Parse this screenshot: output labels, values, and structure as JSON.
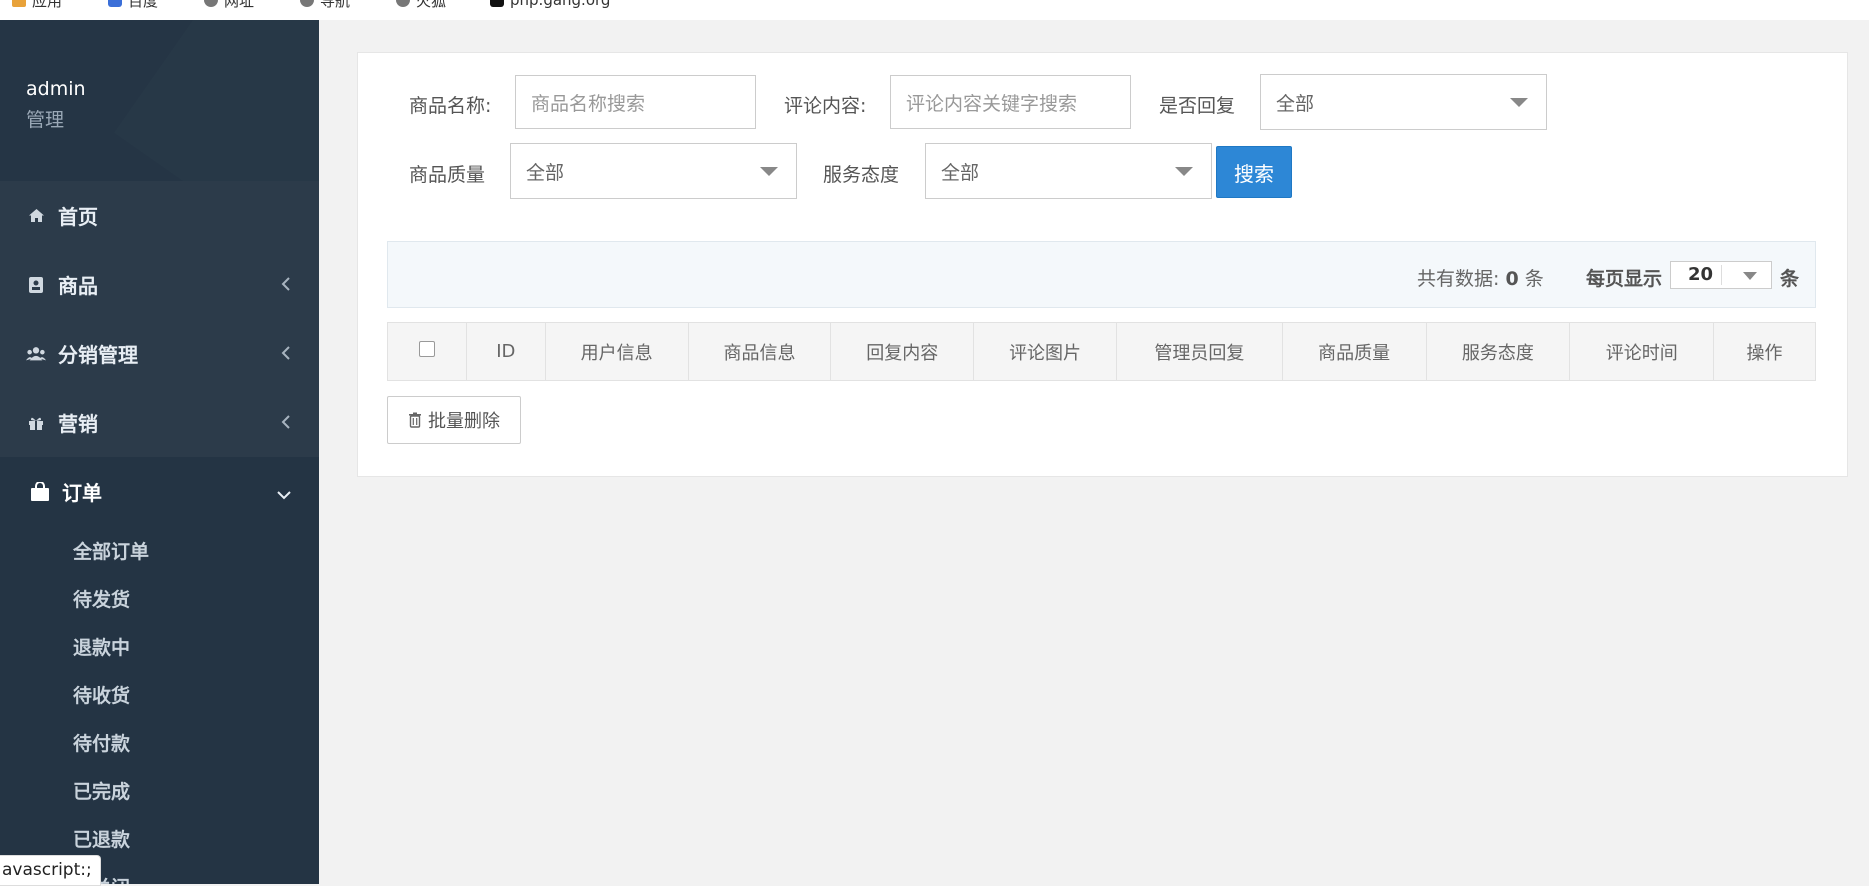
{
  "browser": {
    "bookmarks": [
      {
        "label": "应用",
        "icon": "apps-icon",
        "color": "#e8a23a"
      },
      {
        "label": "百度",
        "icon": "baidu-icon",
        "color": "#3b6fd8"
      },
      {
        "label": "网址",
        "icon": "globe-icon",
        "color": "#777777"
      },
      {
        "label": "导航",
        "icon": "globe-icon",
        "color": "#777777"
      },
      {
        "label": "火狐",
        "icon": "globe-icon",
        "color": "#777777"
      },
      {
        "label": "php.gang.org",
        "icon": "site-icon",
        "color": "#111111"
      }
    ]
  },
  "sidebar": {
    "user_name": "admin",
    "user_role": "管理",
    "menu": [
      {
        "label": "首页",
        "icon": "home-icon",
        "has_arrow": false
      },
      {
        "label": "商品",
        "icon": "product-book-icon",
        "has_arrow": true
      },
      {
        "label": "分销管理",
        "icon": "users-icon",
        "has_arrow": true
      },
      {
        "label": "营销",
        "icon": "gift-icon",
        "has_arrow": true
      },
      {
        "label": "订单",
        "icon": "shopping-bag-icon",
        "has_arrow": true,
        "expanded": true
      }
    ],
    "order_submenu": [
      "全部订单",
      "待发货",
      "退款中",
      "待收货",
      "待付款",
      "已完成",
      "已退款",
      "已关闭"
    ],
    "status_text": "avascript:;"
  },
  "filters": {
    "product_name_label": "商品名称:",
    "product_name_placeholder": "商品名称搜索",
    "comment_label": "评论内容:",
    "comment_placeholder": "评论内容关键字搜索",
    "replied_label": "是否回复",
    "replied_value": "全部",
    "quality_label": "商品质量",
    "quality_value": "全部",
    "service_label": "服务态度",
    "service_value": "全部",
    "search_button": "搜索"
  },
  "summary": {
    "total_label": "共有数据:",
    "total_value": "0",
    "total_unit": "条",
    "per_page_label": "每页显示",
    "per_page_value": "20",
    "per_page_unit": "条"
  },
  "table": {
    "columns": [
      "ID",
      "用户信息",
      "商品信息",
      "回复内容",
      "评论图片",
      "管理员回复",
      "商品质量",
      "服务态度",
      "评论时间",
      "操作"
    ],
    "rows": []
  },
  "actions": {
    "batch_delete": "批量删除"
  },
  "colors": {
    "sidebar_bg": "#2c3b4a",
    "primary_button": "#2d87d6"
  }
}
